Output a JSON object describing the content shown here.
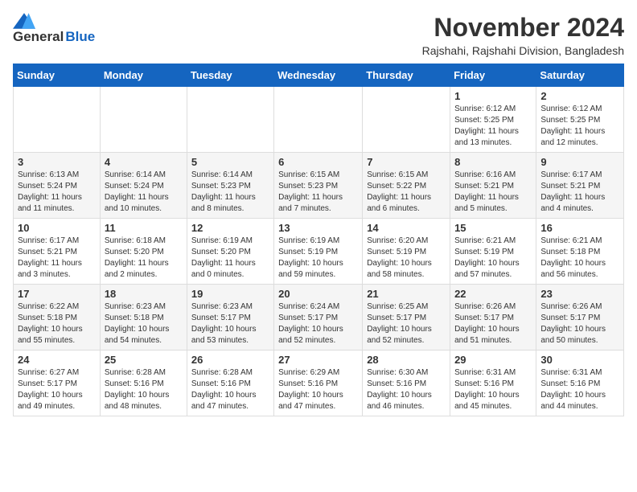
{
  "logo": {
    "general": "General",
    "blue": "Blue"
  },
  "header": {
    "month": "November 2024",
    "location": "Rajshahi, Rajshahi Division, Bangladesh"
  },
  "weekdays": [
    "Sunday",
    "Monday",
    "Tuesday",
    "Wednesday",
    "Thursday",
    "Friday",
    "Saturday"
  ],
  "weeks": [
    [
      {
        "day": "",
        "info": ""
      },
      {
        "day": "",
        "info": ""
      },
      {
        "day": "",
        "info": ""
      },
      {
        "day": "",
        "info": ""
      },
      {
        "day": "",
        "info": ""
      },
      {
        "day": "1",
        "info": "Sunrise: 6:12 AM\nSunset: 5:25 PM\nDaylight: 11 hours and 13 minutes."
      },
      {
        "day": "2",
        "info": "Sunrise: 6:12 AM\nSunset: 5:25 PM\nDaylight: 11 hours and 12 minutes."
      }
    ],
    [
      {
        "day": "3",
        "info": "Sunrise: 6:13 AM\nSunset: 5:24 PM\nDaylight: 11 hours and 11 minutes."
      },
      {
        "day": "4",
        "info": "Sunrise: 6:14 AM\nSunset: 5:24 PM\nDaylight: 11 hours and 10 minutes."
      },
      {
        "day": "5",
        "info": "Sunrise: 6:14 AM\nSunset: 5:23 PM\nDaylight: 11 hours and 8 minutes."
      },
      {
        "day": "6",
        "info": "Sunrise: 6:15 AM\nSunset: 5:23 PM\nDaylight: 11 hours and 7 minutes."
      },
      {
        "day": "7",
        "info": "Sunrise: 6:15 AM\nSunset: 5:22 PM\nDaylight: 11 hours and 6 minutes."
      },
      {
        "day": "8",
        "info": "Sunrise: 6:16 AM\nSunset: 5:21 PM\nDaylight: 11 hours and 5 minutes."
      },
      {
        "day": "9",
        "info": "Sunrise: 6:17 AM\nSunset: 5:21 PM\nDaylight: 11 hours and 4 minutes."
      }
    ],
    [
      {
        "day": "10",
        "info": "Sunrise: 6:17 AM\nSunset: 5:21 PM\nDaylight: 11 hours and 3 minutes."
      },
      {
        "day": "11",
        "info": "Sunrise: 6:18 AM\nSunset: 5:20 PM\nDaylight: 11 hours and 2 minutes."
      },
      {
        "day": "12",
        "info": "Sunrise: 6:19 AM\nSunset: 5:20 PM\nDaylight: 11 hours and 0 minutes."
      },
      {
        "day": "13",
        "info": "Sunrise: 6:19 AM\nSunset: 5:19 PM\nDaylight: 10 hours and 59 minutes."
      },
      {
        "day": "14",
        "info": "Sunrise: 6:20 AM\nSunset: 5:19 PM\nDaylight: 10 hours and 58 minutes."
      },
      {
        "day": "15",
        "info": "Sunrise: 6:21 AM\nSunset: 5:19 PM\nDaylight: 10 hours and 57 minutes."
      },
      {
        "day": "16",
        "info": "Sunrise: 6:21 AM\nSunset: 5:18 PM\nDaylight: 10 hours and 56 minutes."
      }
    ],
    [
      {
        "day": "17",
        "info": "Sunrise: 6:22 AM\nSunset: 5:18 PM\nDaylight: 10 hours and 55 minutes."
      },
      {
        "day": "18",
        "info": "Sunrise: 6:23 AM\nSunset: 5:18 PM\nDaylight: 10 hours and 54 minutes."
      },
      {
        "day": "19",
        "info": "Sunrise: 6:23 AM\nSunset: 5:17 PM\nDaylight: 10 hours and 53 minutes."
      },
      {
        "day": "20",
        "info": "Sunrise: 6:24 AM\nSunset: 5:17 PM\nDaylight: 10 hours and 52 minutes."
      },
      {
        "day": "21",
        "info": "Sunrise: 6:25 AM\nSunset: 5:17 PM\nDaylight: 10 hours and 52 minutes."
      },
      {
        "day": "22",
        "info": "Sunrise: 6:26 AM\nSunset: 5:17 PM\nDaylight: 10 hours and 51 minutes."
      },
      {
        "day": "23",
        "info": "Sunrise: 6:26 AM\nSunset: 5:17 PM\nDaylight: 10 hours and 50 minutes."
      }
    ],
    [
      {
        "day": "24",
        "info": "Sunrise: 6:27 AM\nSunset: 5:17 PM\nDaylight: 10 hours and 49 minutes."
      },
      {
        "day": "25",
        "info": "Sunrise: 6:28 AM\nSunset: 5:16 PM\nDaylight: 10 hours and 48 minutes."
      },
      {
        "day": "26",
        "info": "Sunrise: 6:28 AM\nSunset: 5:16 PM\nDaylight: 10 hours and 47 minutes."
      },
      {
        "day": "27",
        "info": "Sunrise: 6:29 AM\nSunset: 5:16 PM\nDaylight: 10 hours and 47 minutes."
      },
      {
        "day": "28",
        "info": "Sunrise: 6:30 AM\nSunset: 5:16 PM\nDaylight: 10 hours and 46 minutes."
      },
      {
        "day": "29",
        "info": "Sunrise: 6:31 AM\nSunset: 5:16 PM\nDaylight: 10 hours and 45 minutes."
      },
      {
        "day": "30",
        "info": "Sunrise: 6:31 AM\nSunset: 5:16 PM\nDaylight: 10 hours and 44 minutes."
      }
    ]
  ]
}
